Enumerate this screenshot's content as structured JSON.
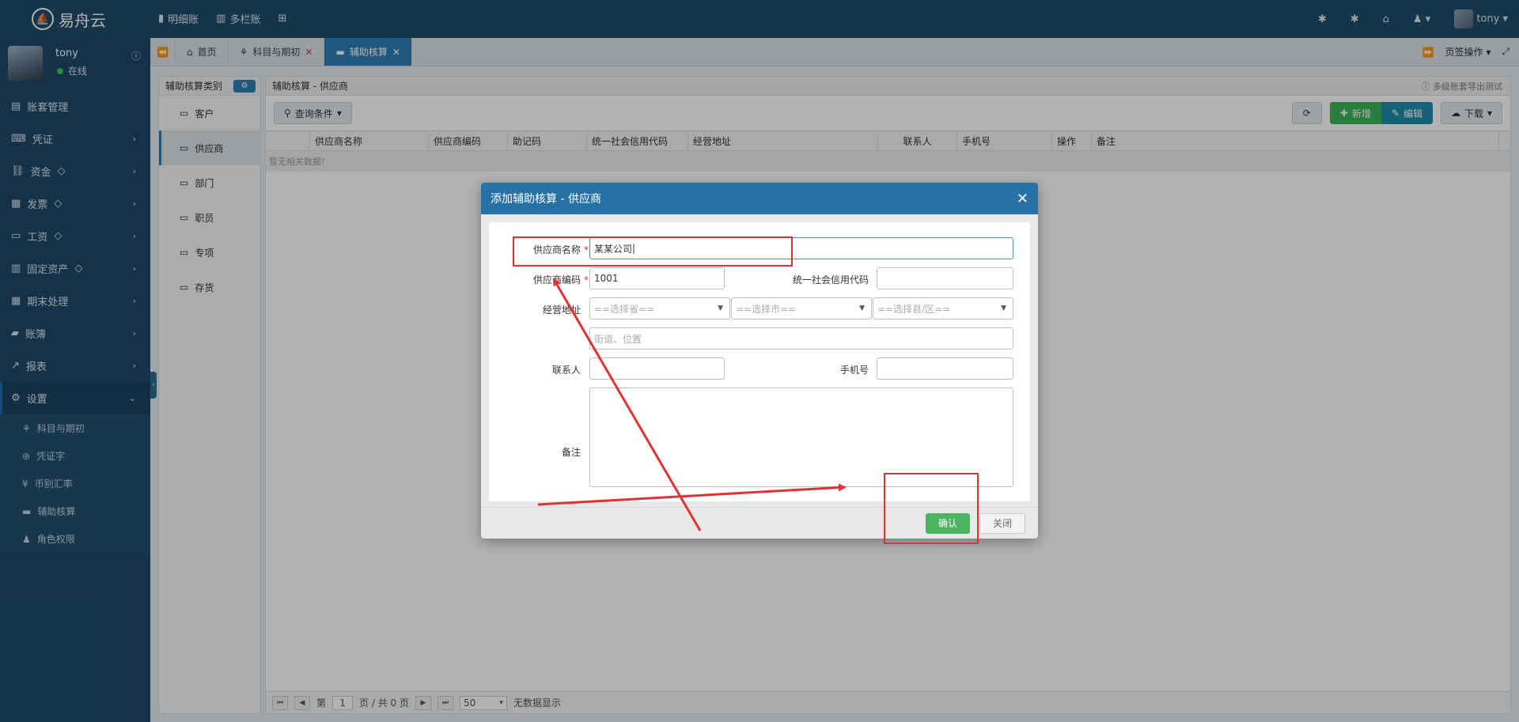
{
  "app": {
    "name": "易舟云",
    "topnav": [
      "明细账",
      "多栏账"
    ],
    "user": "tony",
    "status": "在线"
  },
  "sidebar": {
    "items": [
      {
        "label": "账套管理",
        "icon": "table-icon",
        "chevron": false,
        "gem": false
      },
      {
        "label": "凭证",
        "icon": "keyboard-icon",
        "chevron": true,
        "gem": false
      },
      {
        "label": "资金",
        "icon": "link-icon",
        "chevron": true,
        "gem": true
      },
      {
        "label": "发票",
        "icon": "invoice-icon",
        "chevron": true,
        "gem": true
      },
      {
        "label": "工资",
        "icon": "card-icon",
        "chevron": true,
        "gem": true
      },
      {
        "label": "固定资产",
        "icon": "building-icon",
        "chevron": true,
        "gem": true
      },
      {
        "label": "期末处理",
        "icon": "calendar-icon",
        "chevron": true,
        "gem": false
      },
      {
        "label": "账簿",
        "icon": "book-icon",
        "chevron": true,
        "gem": false
      },
      {
        "label": "报表",
        "icon": "chart-icon",
        "chevron": true,
        "gem": false
      },
      {
        "label": "设置",
        "icon": "gear-icon",
        "chevron": true,
        "gem": false
      }
    ],
    "subitems": [
      "科目与期初",
      "凭证字",
      "币别汇率",
      "辅助核算",
      "角色权限"
    ]
  },
  "tabs": [
    {
      "label": "首页"
    },
    {
      "label": "科目与期初"
    },
    {
      "label": "辅助核算"
    }
  ],
  "tab_ops": "页签操作",
  "categories": {
    "title": "辅助核算类别",
    "items": [
      "客户",
      "供应商",
      "部门",
      "职员",
      "专项",
      "存货"
    ]
  },
  "main": {
    "title": "辅助核算 - 供应商",
    "hint": "多级账套导出测试",
    "query_label": "查询条件",
    "add_label": "新增",
    "edit_label": "编辑",
    "download_label": "下载",
    "columns": [
      "供应商名称",
      "供应商编码",
      "助记码",
      "统一社会信用代码",
      "经营地址",
      "联系人",
      "手机号",
      "操作",
      "备注"
    ],
    "nodata": "暂无相关数据!",
    "pager": {
      "page_prefix": "第",
      "page": "1",
      "page_suffix": "页 / 共 0 页",
      "size": "50",
      "info": "无数据显示"
    }
  },
  "modal": {
    "title": "添加辅助核算 - 供应商",
    "name_label": "供应商名称",
    "name_value": "某某公司",
    "code_label": "供应商编码",
    "code_value": "1001",
    "credit_label": "统一社会信用代码",
    "address_label": "经营地址",
    "province_ph": "==选择省==",
    "city_ph": "==选择市==",
    "county_ph": "==选择县/区==",
    "street_ph": "街道、位置",
    "contact_label": "联系人",
    "phone_label": "手机号",
    "remark_label": "备注",
    "confirm_label": "确认",
    "close_label": "关闭"
  },
  "colors": {
    "topbar": "#1f4d6c",
    "sidebar": "#1d4a69",
    "accent": "#2f7fb4",
    "green": "#3cb55a",
    "annotation": "#e03232"
  }
}
